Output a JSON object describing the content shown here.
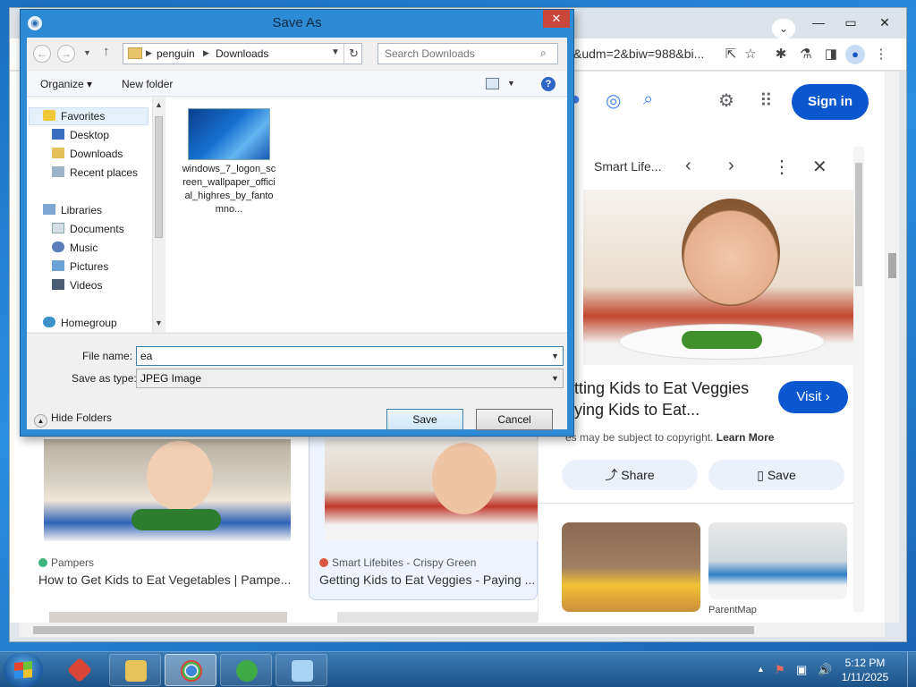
{
  "chrome": {
    "url_fragment": "&udm=2&biw=988&bi...",
    "signin_label": "Sign in"
  },
  "panel": {
    "source": "Smart Life...",
    "title": "etting Kids to Eat Veggies aying Kids to Eat...",
    "visit_label": "Visit ›",
    "copyright_text": "es may be subject to copyright.",
    "learn_more": "Learn More",
    "share_label": "Share",
    "save_label": "Save",
    "thumb_source": "ParentMap"
  },
  "results": [
    {
      "source": "Pampers",
      "title": "How to Get Kids to Eat Vegetables | Pampe..."
    },
    {
      "source": "Smart Lifebites - Crispy Green",
      "title": "Getting Kids to Eat Veggies - Paying ..."
    }
  ],
  "dialog": {
    "title": "Save As",
    "address": [
      "penguin",
      "Downloads"
    ],
    "search_placeholder": "Search Downloads",
    "organize_label": "Organize ▾",
    "new_folder_label": "New folder",
    "nav": {
      "favorites": "Favorites",
      "desktop": "Desktop",
      "downloads": "Downloads",
      "recent": "Recent places",
      "libraries": "Libraries",
      "documents": "Documents",
      "music": "Music",
      "pictures": "Pictures",
      "videos": "Videos",
      "homegroup": "Homegroup"
    },
    "file": {
      "name": "windows_7_logon_screen_wallpaper_official_highres_by_fantomno..."
    },
    "file_name_label": "File name:",
    "file_name_value": "ea",
    "save_type_label": "Save as type:",
    "save_type_value": "JPEG Image",
    "hide_folders_label": "Hide Folders",
    "save_button": "Save",
    "cancel_button": "Cancel"
  },
  "taskbar": {
    "time": "5:12 PM",
    "date": "1/11/2025"
  },
  "colors": {
    "accent": "#0b57d0",
    "dialog_frame": "#2d8ad4"
  }
}
